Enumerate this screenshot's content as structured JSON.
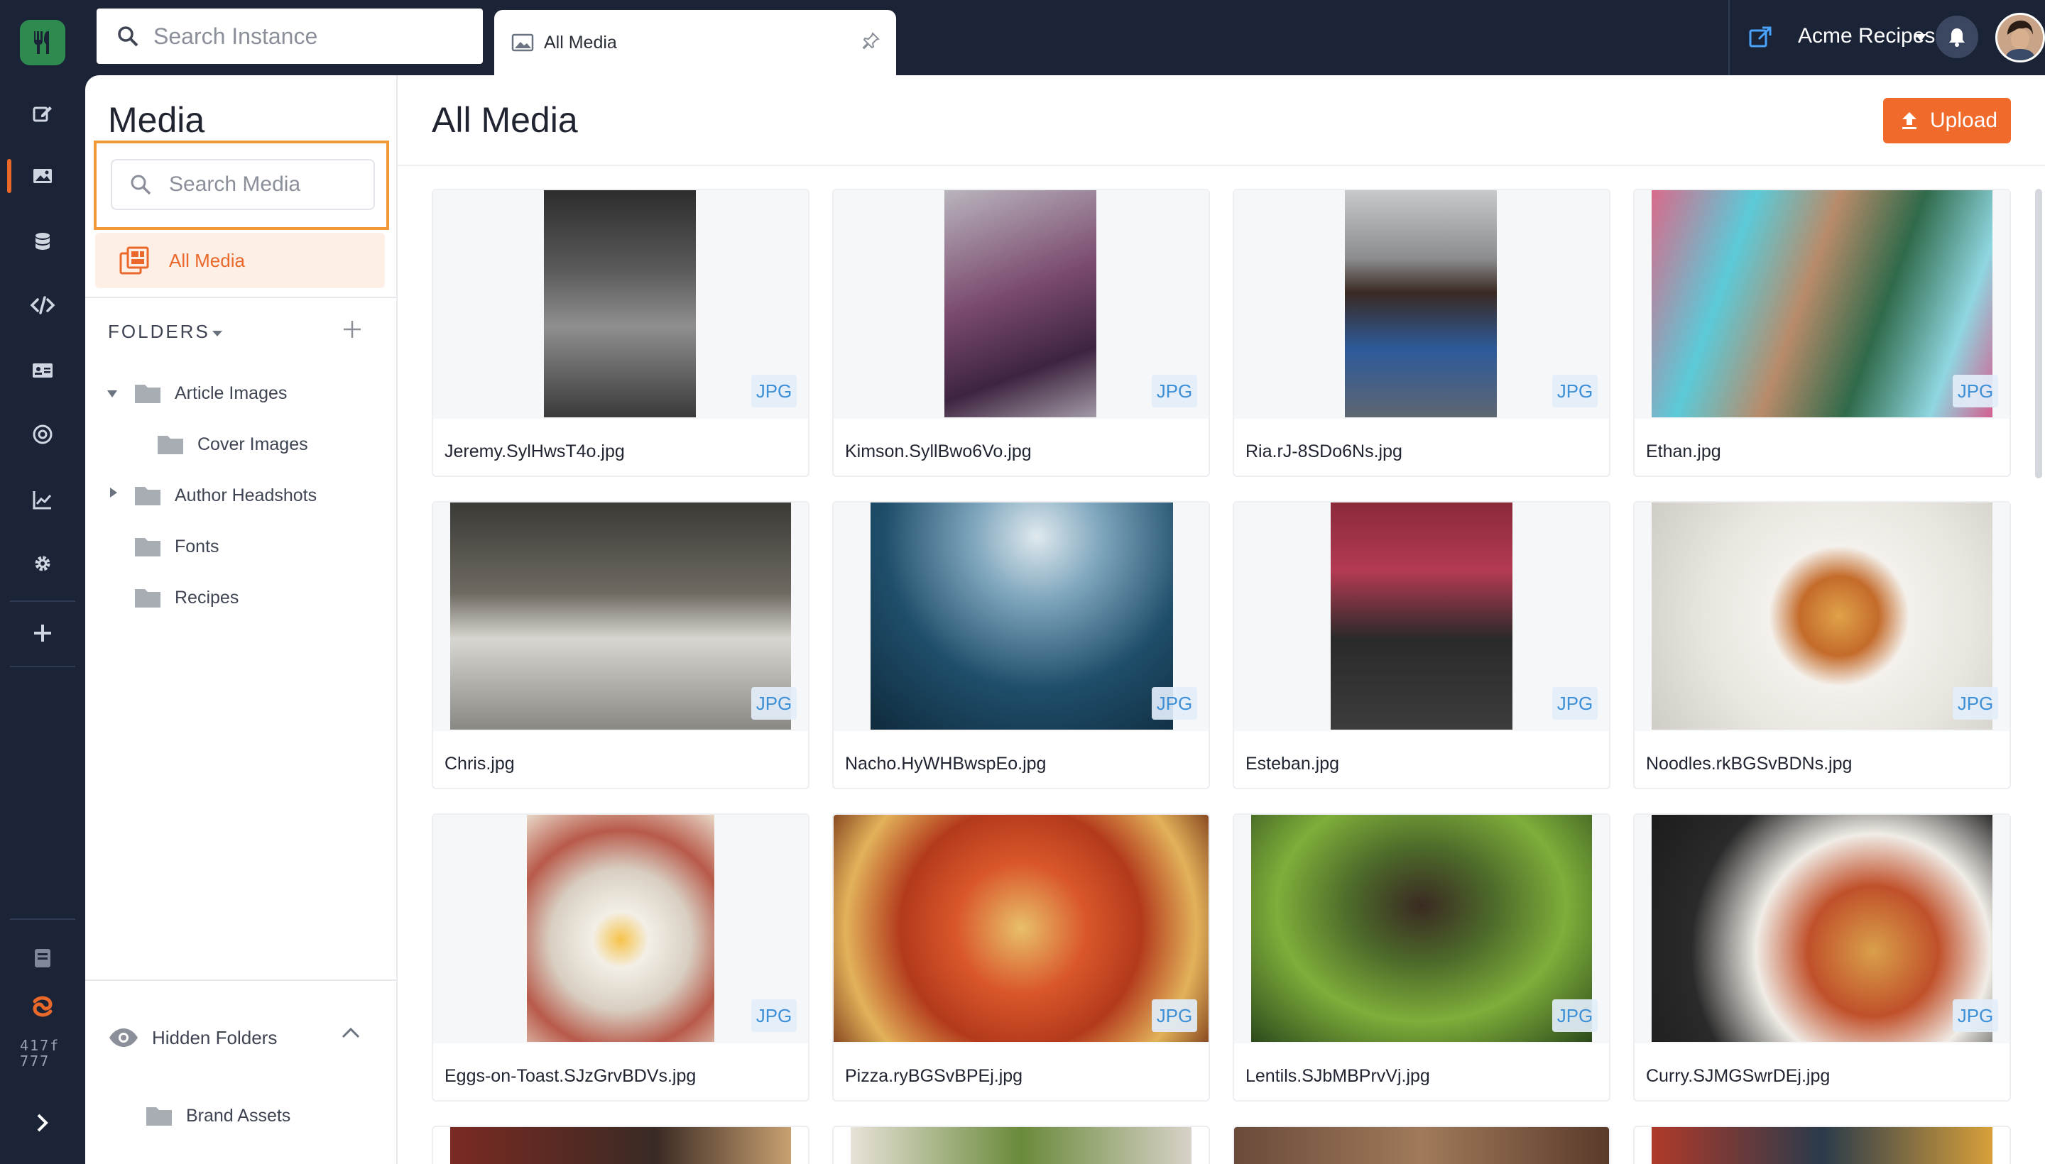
{
  "topbar": {
    "search_placeholder": "Search Instance",
    "tab_label": "All Media",
    "org_name": "Acme Recipes"
  },
  "rail": {
    "version_line1": "417f",
    "version_line2": "777"
  },
  "panel": {
    "title": "Media",
    "search_placeholder": "Search Media",
    "all_media_label": "All Media",
    "folders_header": "FOLDERS",
    "folders": [
      {
        "name": "Article Images"
      },
      {
        "name": "Cover Images"
      },
      {
        "name": "Author Headshots"
      },
      {
        "name": "Fonts"
      },
      {
        "name": "Recipes"
      }
    ],
    "hidden_header": "Hidden Folders",
    "hidden_folders": [
      {
        "name": "Brand Assets"
      }
    ]
  },
  "main": {
    "title": "All Media",
    "upload_label": "Upload",
    "items": [
      {
        "name": "Jeremy.SylHwsT4o.jpg",
        "type": "JPG"
      },
      {
        "name": "Kimson.SyllBwo6Vo.jpg",
        "type": "JPG"
      },
      {
        "name": "Ria.rJ-8SDo6Ns.jpg",
        "type": "JPG"
      },
      {
        "name": "Ethan.jpg",
        "type": "JPG"
      },
      {
        "name": "Chris.jpg",
        "type": "JPG"
      },
      {
        "name": "Nacho.HyWHBwspEo.jpg",
        "type": "JPG"
      },
      {
        "name": "Esteban.jpg",
        "type": "JPG"
      },
      {
        "name": "Noodles.rkBGSvBDNs.jpg",
        "type": "JPG"
      },
      {
        "name": "Eggs-on-Toast.SJzGrvBDVs.jpg",
        "type": "JPG"
      },
      {
        "name": "Pizza.ryBGSvBPEj.jpg",
        "type": "JPG"
      },
      {
        "name": "Lentils.SJbMBPrvVj.jpg",
        "type": "JPG"
      },
      {
        "name": "Curry.SJMGSwrDEj.jpg",
        "type": "JPG"
      }
    ]
  }
}
